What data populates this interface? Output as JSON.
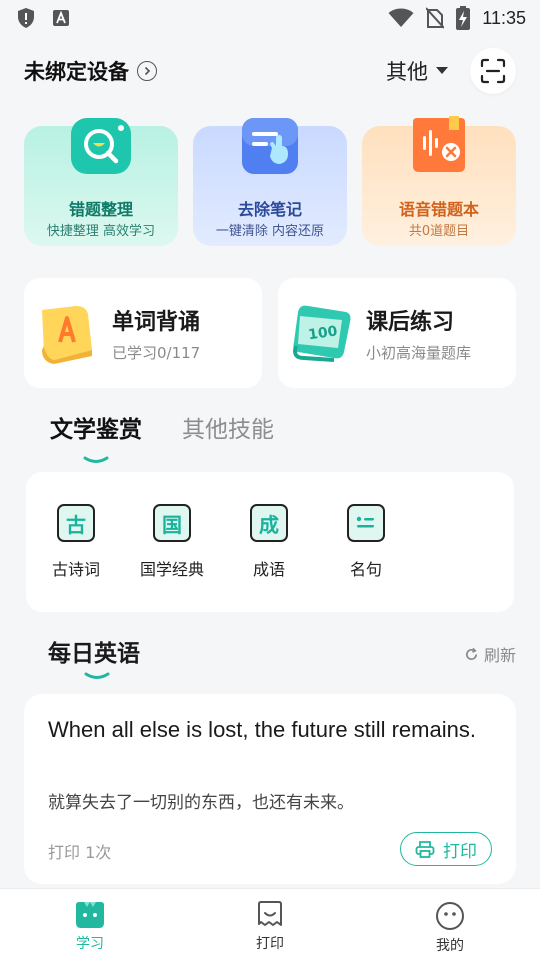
{
  "status_bar": {
    "time": "11:35"
  },
  "header": {
    "device_title": "未绑定设备",
    "other_label": "其他"
  },
  "features": [
    {
      "title": "错题整理",
      "subtitle": "快捷整理 高效学习",
      "icon": "magnifier-icon"
    },
    {
      "title": "去除笔记",
      "subtitle": "一键清除 内容还原",
      "icon": "eraser-hand-icon"
    },
    {
      "title": "语音错题本",
      "subtitle": "共0道题目",
      "icon": "voice-book-icon"
    }
  ],
  "mid_cards": [
    {
      "title": "单词背诵",
      "subtitle": "已学习0/117",
      "icon": "word-book-icon"
    },
    {
      "title": "课后练习",
      "subtitle": "小初高海量题库",
      "icon": "exercise-scroll-icon"
    }
  ],
  "tabs": [
    {
      "label": "文学鉴赏",
      "active": true
    },
    {
      "label": "其他技能",
      "active": false
    }
  ],
  "literature_items": [
    {
      "glyph": "古",
      "label": "古诗词"
    },
    {
      "glyph": "国",
      "label": "国学经典"
    },
    {
      "glyph": "成",
      "label": "成语"
    },
    {
      "glyph": "",
      "label": "名句"
    }
  ],
  "daily": {
    "title": "每日英语",
    "refresh_label": "刷新",
    "quote_en": "When all else is lost, the future still remains.",
    "quote_cn": "就算失去了一切别的东西，也还有未来。",
    "print_count": "打印 1次",
    "print_button": "打印"
  },
  "nav": [
    {
      "label": "学习",
      "active": true
    },
    {
      "label": "打印",
      "active": false
    },
    {
      "label": "我的",
      "active": false
    }
  ],
  "colors": {
    "accent": "#22b8a0",
    "page_bg": "#f5f6f8",
    "card_bg": "#ffffff"
  }
}
